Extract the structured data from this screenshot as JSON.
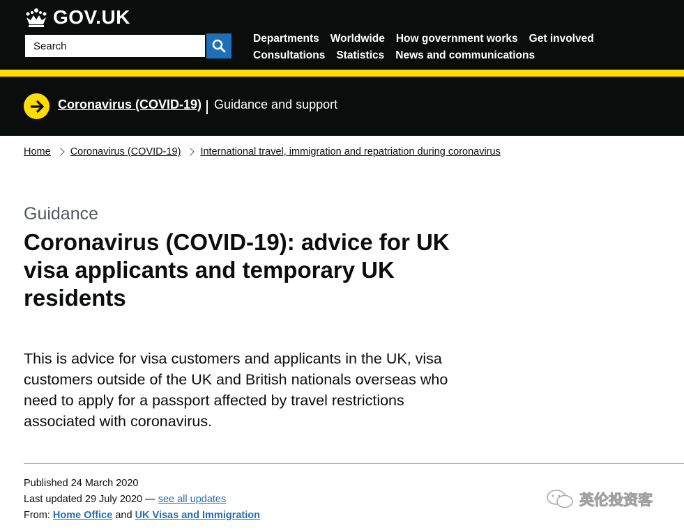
{
  "header": {
    "logo_text": "GOV.UK",
    "search": {
      "placeholder": "Search",
      "value": ""
    },
    "nav_row1": [
      "Departments",
      "Worldwide",
      "How government works",
      "Get involved"
    ],
    "nav_row2": [
      "Consultations",
      "Statistics",
      "News and communications"
    ]
  },
  "topic": {
    "link": "Coronavirus (COVID-19)",
    "subtitle": "Guidance and support"
  },
  "breadcrumbs": [
    "Home",
    "Coronavirus (COVID-19)",
    "International travel, immigration and repatriation during coronavirus"
  ],
  "main": {
    "caption": "Guidance",
    "title": "Coronavirus (COVID-19): advice for UK visa applicants and temporary UK residents",
    "lede": "This is advice for visa customers and applicants in the UK, visa customers outside of the UK and British nationals overseas who need to apply for a passport affected by travel restrictions associated with coronavirus."
  },
  "metadata": {
    "published_label": "Published",
    "published_date": "24 March 2020",
    "updated_label": "Last updated",
    "updated_date": "29 July 2020",
    "updated_dash": "—",
    "see_updates": "see all updates",
    "from_label": "From:",
    "org1": "Home Office",
    "and": "and",
    "org2": "UK Visas and Immigration"
  },
  "watermark": {
    "text": "英伦投资客"
  },
  "colors": {
    "black": "#0b0c0c",
    "yellow": "#ffdd00",
    "link_blue": "#1d70b8",
    "secondary_text": "#505a5f"
  }
}
